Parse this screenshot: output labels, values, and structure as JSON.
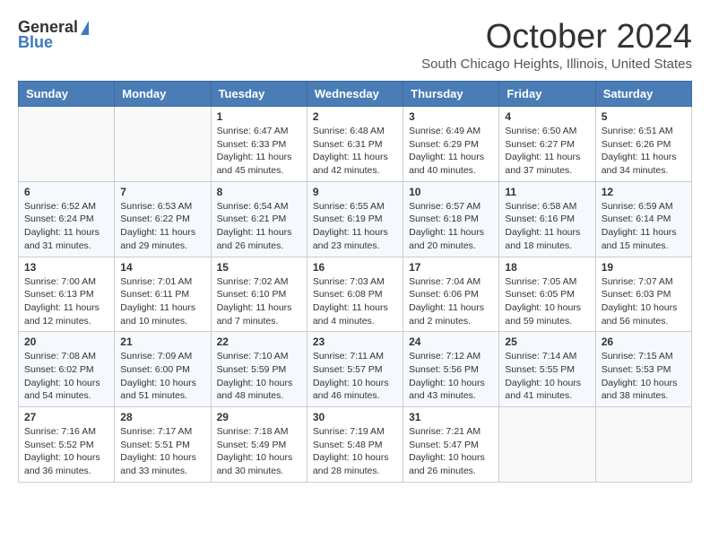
{
  "header": {
    "logo_general": "General",
    "logo_blue": "Blue",
    "month_title": "October 2024",
    "location": "South Chicago Heights, Illinois, United States"
  },
  "weekdays": [
    "Sunday",
    "Monday",
    "Tuesday",
    "Wednesday",
    "Thursday",
    "Friday",
    "Saturday"
  ],
  "weeks": [
    [
      {
        "day": "",
        "info": ""
      },
      {
        "day": "",
        "info": ""
      },
      {
        "day": "1",
        "info": "Sunrise: 6:47 AM\nSunset: 6:33 PM\nDaylight: 11 hours and 45 minutes."
      },
      {
        "day": "2",
        "info": "Sunrise: 6:48 AM\nSunset: 6:31 PM\nDaylight: 11 hours and 42 minutes."
      },
      {
        "day": "3",
        "info": "Sunrise: 6:49 AM\nSunset: 6:29 PM\nDaylight: 11 hours and 40 minutes."
      },
      {
        "day": "4",
        "info": "Sunrise: 6:50 AM\nSunset: 6:27 PM\nDaylight: 11 hours and 37 minutes."
      },
      {
        "day": "5",
        "info": "Sunrise: 6:51 AM\nSunset: 6:26 PM\nDaylight: 11 hours and 34 minutes."
      }
    ],
    [
      {
        "day": "6",
        "info": "Sunrise: 6:52 AM\nSunset: 6:24 PM\nDaylight: 11 hours and 31 minutes."
      },
      {
        "day": "7",
        "info": "Sunrise: 6:53 AM\nSunset: 6:22 PM\nDaylight: 11 hours and 29 minutes."
      },
      {
        "day": "8",
        "info": "Sunrise: 6:54 AM\nSunset: 6:21 PM\nDaylight: 11 hours and 26 minutes."
      },
      {
        "day": "9",
        "info": "Sunrise: 6:55 AM\nSunset: 6:19 PM\nDaylight: 11 hours and 23 minutes."
      },
      {
        "day": "10",
        "info": "Sunrise: 6:57 AM\nSunset: 6:18 PM\nDaylight: 11 hours and 20 minutes."
      },
      {
        "day": "11",
        "info": "Sunrise: 6:58 AM\nSunset: 6:16 PM\nDaylight: 11 hours and 18 minutes."
      },
      {
        "day": "12",
        "info": "Sunrise: 6:59 AM\nSunset: 6:14 PM\nDaylight: 11 hours and 15 minutes."
      }
    ],
    [
      {
        "day": "13",
        "info": "Sunrise: 7:00 AM\nSunset: 6:13 PM\nDaylight: 11 hours and 12 minutes."
      },
      {
        "day": "14",
        "info": "Sunrise: 7:01 AM\nSunset: 6:11 PM\nDaylight: 11 hours and 10 minutes."
      },
      {
        "day": "15",
        "info": "Sunrise: 7:02 AM\nSunset: 6:10 PM\nDaylight: 11 hours and 7 minutes."
      },
      {
        "day": "16",
        "info": "Sunrise: 7:03 AM\nSunset: 6:08 PM\nDaylight: 11 hours and 4 minutes."
      },
      {
        "day": "17",
        "info": "Sunrise: 7:04 AM\nSunset: 6:06 PM\nDaylight: 11 hours and 2 minutes."
      },
      {
        "day": "18",
        "info": "Sunrise: 7:05 AM\nSunset: 6:05 PM\nDaylight: 10 hours and 59 minutes."
      },
      {
        "day": "19",
        "info": "Sunrise: 7:07 AM\nSunset: 6:03 PM\nDaylight: 10 hours and 56 minutes."
      }
    ],
    [
      {
        "day": "20",
        "info": "Sunrise: 7:08 AM\nSunset: 6:02 PM\nDaylight: 10 hours and 54 minutes."
      },
      {
        "day": "21",
        "info": "Sunrise: 7:09 AM\nSunset: 6:00 PM\nDaylight: 10 hours and 51 minutes."
      },
      {
        "day": "22",
        "info": "Sunrise: 7:10 AM\nSunset: 5:59 PM\nDaylight: 10 hours and 48 minutes."
      },
      {
        "day": "23",
        "info": "Sunrise: 7:11 AM\nSunset: 5:57 PM\nDaylight: 10 hours and 46 minutes."
      },
      {
        "day": "24",
        "info": "Sunrise: 7:12 AM\nSunset: 5:56 PM\nDaylight: 10 hours and 43 minutes."
      },
      {
        "day": "25",
        "info": "Sunrise: 7:14 AM\nSunset: 5:55 PM\nDaylight: 10 hours and 41 minutes."
      },
      {
        "day": "26",
        "info": "Sunrise: 7:15 AM\nSunset: 5:53 PM\nDaylight: 10 hours and 38 minutes."
      }
    ],
    [
      {
        "day": "27",
        "info": "Sunrise: 7:16 AM\nSunset: 5:52 PM\nDaylight: 10 hours and 36 minutes."
      },
      {
        "day": "28",
        "info": "Sunrise: 7:17 AM\nSunset: 5:51 PM\nDaylight: 10 hours and 33 minutes."
      },
      {
        "day": "29",
        "info": "Sunrise: 7:18 AM\nSunset: 5:49 PM\nDaylight: 10 hours and 30 minutes."
      },
      {
        "day": "30",
        "info": "Sunrise: 7:19 AM\nSunset: 5:48 PM\nDaylight: 10 hours and 28 minutes."
      },
      {
        "day": "31",
        "info": "Sunrise: 7:21 AM\nSunset: 5:47 PM\nDaylight: 10 hours and 26 minutes."
      },
      {
        "day": "",
        "info": ""
      },
      {
        "day": "",
        "info": ""
      }
    ]
  ]
}
